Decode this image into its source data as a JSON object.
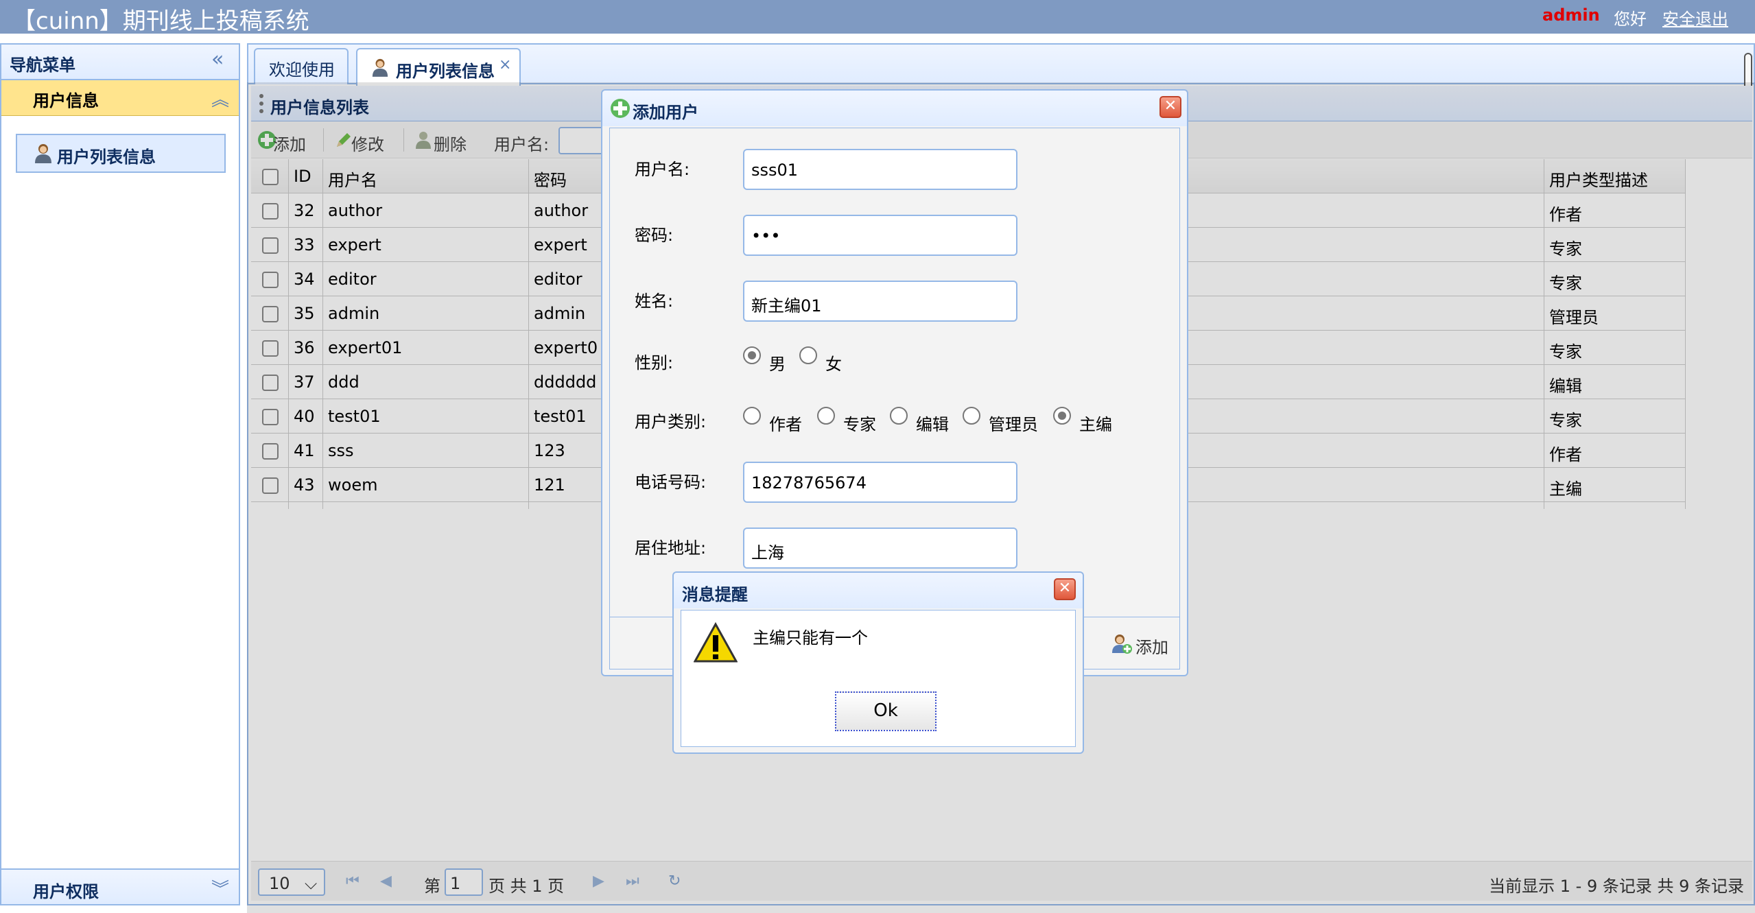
{
  "header": {
    "title": "【cuinn】期刊线上投稿系统",
    "user": "admin",
    "greeting": "您好",
    "logout": "安全退出"
  },
  "nav": {
    "title": "导航菜单",
    "sections": [
      {
        "label": "用户信息",
        "expanded": true,
        "items": [
          {
            "label": "用户列表信息"
          }
        ]
      },
      {
        "label": "用户权限",
        "expanded": false
      }
    ]
  },
  "tabs": [
    {
      "label": "欢迎使用"
    },
    {
      "label": "用户列表信息",
      "active": true,
      "close": "×"
    }
  ],
  "panel": {
    "title": "用户信息列表",
    "toolbar": {
      "add": "添加",
      "edit": "修改",
      "delete": "删除",
      "search_label": "用户名:"
    }
  },
  "grid": {
    "columns": [
      "ID",
      "用户名",
      "密码",
      "用户类型描述"
    ],
    "rows": [
      {
        "id": "32",
        "username": "author",
        "password": "author",
        "type": "作者"
      },
      {
        "id": "33",
        "username": "expert",
        "password": "expert",
        "type": "专家"
      },
      {
        "id": "34",
        "username": "editor",
        "password": "editor",
        "type": "专家"
      },
      {
        "id": "35",
        "username": "admin",
        "password": "admin",
        "type": "管理员"
      },
      {
        "id": "36",
        "username": "expert01",
        "password": "expert0",
        "type": "专家"
      },
      {
        "id": "37",
        "username": "ddd",
        "password": "dddddd",
        "type": "编辑"
      },
      {
        "id": "40",
        "username": "test01",
        "password": "test01",
        "type": "专家"
      },
      {
        "id": "41",
        "username": "sss",
        "password": "123",
        "type": "作者"
      },
      {
        "id": "43",
        "username": "woem",
        "password": "121",
        "type": "主编"
      }
    ]
  },
  "pager": {
    "page_size": "10",
    "page_prefix": "第",
    "page": "1",
    "page_suffix": "页 共 1 页",
    "summary": "当前显示 1 - 9 条记录 共 9 条记录"
  },
  "dialog": {
    "title": "添加用户",
    "fields": {
      "username_label": "用户名:",
      "username": "sss01",
      "password_label": "密码:",
      "password": "•••",
      "name_label": "姓名:",
      "name": "新主编01",
      "gender_label": "性别:",
      "gender_options": [
        "男",
        "女"
      ],
      "gender_selected": "男",
      "type_label": "用户类别:",
      "type_options": [
        "作者",
        "专家",
        "编辑",
        "管理员",
        "主编"
      ],
      "type_selected": "主编",
      "phone_label": "电话号码:",
      "phone": "18278765674",
      "address_label": "居住地址:",
      "address": "上海"
    },
    "add_button": "添加"
  },
  "message": {
    "title": "消息提醒",
    "text": "主编只能有一个",
    "ok": "Ok"
  },
  "colors": {
    "header_bg": "#7f9ac2",
    "border": "#95b8e7",
    "accent_yellow": "#ffe48d",
    "user_red": "#e00000"
  }
}
